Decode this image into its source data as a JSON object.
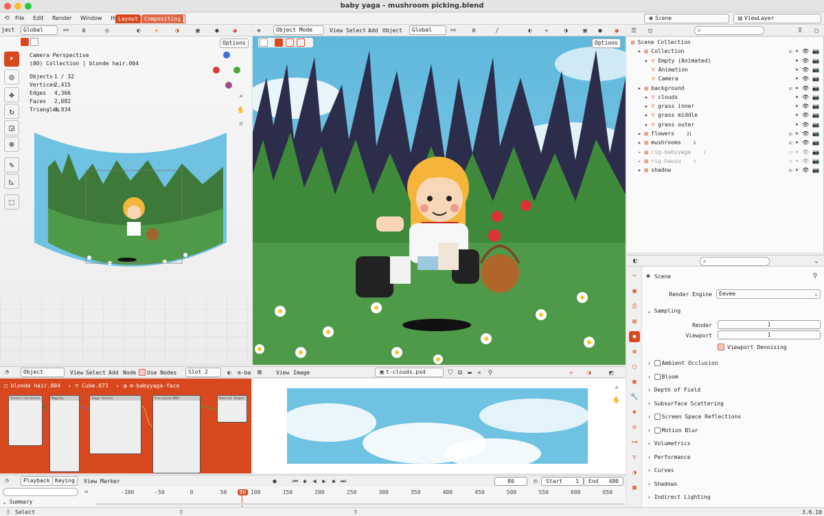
{
  "title": "baby yaga - mushroom picking.blend",
  "menu": [
    "File",
    "Edit",
    "Render",
    "Window",
    "Help"
  ],
  "workspace_tabs": [
    "Layout",
    "Compositing"
  ],
  "scene": {
    "scene": "Scene",
    "view_layer": "ViewLayer"
  },
  "left_viewport": {
    "header_left": "ject",
    "transform": "Global",
    "options": "Options",
    "info": [
      "Camera Perspective",
      "(80) Collection | blonde hair.004"
    ],
    "stats": [
      {
        "k": "Objects",
        "v": "1 / 32"
      },
      {
        "k": "Vertices",
        "v": "2,415"
      },
      {
        "k": "Edges",
        "v": "4,366"
      },
      {
        "k": "Faces",
        "v": "2,082"
      },
      {
        "k": "Triangles",
        "v": "3,934"
      }
    ]
  },
  "main_viewport": {
    "mode": "Object Mode",
    "menus": [
      "View",
      "Select",
      "Add",
      "Object"
    ],
    "transform": "Global",
    "options": "Options"
  },
  "outliner": {
    "items": [
      {
        "label": "Scene Collection",
        "indent": 0
      },
      {
        "label": "Collection",
        "indent": 1
      },
      {
        "label": "Empty (Animated)",
        "indent": 2
      },
      {
        "label": "Animation",
        "indent": 3
      },
      {
        "label": "Camera",
        "indent": 3
      },
      {
        "label": "background",
        "indent": 1
      },
      {
        "label": "clouds",
        "indent": 2
      },
      {
        "label": "grass inner",
        "indent": 2
      },
      {
        "label": "grass middle",
        "indent": 2
      },
      {
        "label": "grass outer",
        "indent": 2
      },
      {
        "label": "flowers",
        "indent": 1,
        "sub": "21"
      },
      {
        "label": "mushrooms",
        "indent": 1,
        "sub": "2"
      },
      {
        "label": "rig-babyyaga",
        "indent": 1,
        "sub": "2",
        "dim": true
      },
      {
        "label": "rig-hausu",
        "indent": 1,
        "sub": "3",
        "dim": true
      },
      {
        "label": "shadow",
        "indent": 1
      }
    ]
  },
  "properties": {
    "scene_label": "Scene",
    "render_engine_label": "Render Engine",
    "render_engine": "Eevee",
    "sampling": "Sampling",
    "render_label": "Render",
    "render_val": "1",
    "viewport_label": "Viewport",
    "viewport_val": "1",
    "denoise": "Viewport Denoising",
    "sections": [
      "Ambient Occlusion",
      "Bloom",
      "Depth of Field",
      "Subsurface Scattering",
      "Screen Space Reflections",
      "Motion Blur",
      "Volumetrics",
      "Performance",
      "Curves",
      "Shadows",
      "Indirect Lighting"
    ],
    "checkbox_sections": [
      0,
      1,
      4,
      5
    ]
  },
  "shader_editor": {
    "object": "Object",
    "menus": [
      "View",
      "Select",
      "Add",
      "Node"
    ],
    "use_nodes": "Use Nodes",
    "slot": "Slot 2",
    "material": "m-ba",
    "breadcrumb": [
      "blonde hair.004",
      "Cube.073",
      "m-babyyaga-face"
    ],
    "nodes": [
      "Texture Coordinate",
      "Mapping",
      "Image Texture",
      "Principled BSDF",
      "Material Output"
    ]
  },
  "image_editor": {
    "menus": [
      "View",
      "Image"
    ],
    "image": "t-clouds.psd"
  },
  "timeline": {
    "playback": "Playback",
    "keying": "Keying",
    "view": "View",
    "marker": "Marker",
    "frame": "80",
    "start_label": "Start",
    "start": "1",
    "end_label": "End",
    "end": "480",
    "ticks": [
      "-100",
      "-50",
      "0",
      "50",
      "80",
      "100",
      "150",
      "200",
      "250",
      "300",
      "350",
      "400",
      "450",
      "500",
      "550",
      "600",
      "650"
    ],
    "summary": "Summary"
  },
  "status": {
    "left": "Select",
    "version": "3.6.10"
  },
  "colors": {
    "accent": "#d8481f",
    "sky": "#6fc2e2",
    "grass": "#4e9a48",
    "bg": "#e9e9e9"
  }
}
